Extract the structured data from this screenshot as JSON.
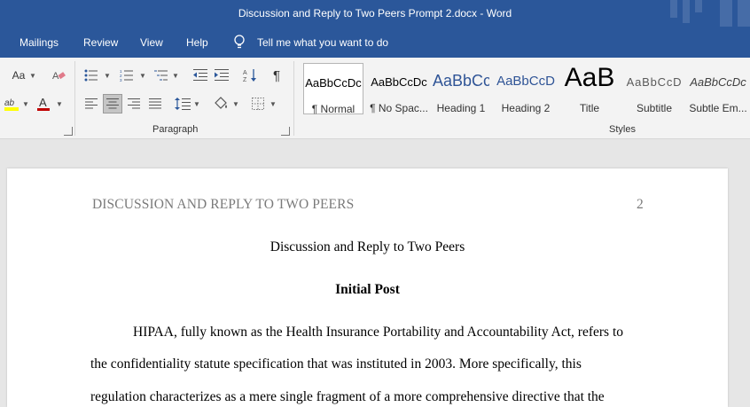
{
  "window": {
    "title": "Discussion and Reply to Two Peers Prompt 2.docx  -  Word"
  },
  "tabs": [
    {
      "label": "Mailings"
    },
    {
      "label": "Review"
    },
    {
      "label": "View"
    },
    {
      "label": "Help"
    }
  ],
  "tell_me": {
    "icon": "lightbulb-icon",
    "label": "Tell me what you want to do"
  },
  "ribbon": {
    "font_group": {
      "change_case_label": "Aa",
      "font_color": "#c00000",
      "highlight_color": "#ffff00"
    },
    "paragraph_group": {
      "label": "Paragraph",
      "active_alignment": "align-left"
    },
    "styles_group": {
      "label": "Styles",
      "items": [
        {
          "sample": "AaBbCcDc",
          "name": "¶ Normal"
        },
        {
          "sample": "AaBbCcDc",
          "name": "¶ No Spac..."
        },
        {
          "sample": "AaBbCc",
          "name": "Heading 1"
        },
        {
          "sample": "AaBbCcD",
          "name": "Heading 2"
        },
        {
          "sample": "AaB",
          "name": "Title"
        },
        {
          "sample": "AaBbCcD",
          "name": "Subtitle"
        },
        {
          "sample": "AaBbCcDc",
          "name": "Subtle Em..."
        }
      ],
      "selected": "¶ Normal"
    }
  },
  "document": {
    "running_header": "DISCUSSION AND REPLY TO TWO PEERS",
    "page_number": "2",
    "title": "Discussion and Reply to Two Peers",
    "heading": "Initial Post",
    "body_lines": [
      "HIPAA, fully known as the Health Insurance Portability and Accountability Act, refers to",
      "the confidentiality statute specification that was instituted in 2003. More specifically, this",
      "regulation characterizes as a mere single fragment of a more comprehensive directive that the"
    ]
  },
  "colors": {
    "accent": "#2b579a",
    "ribbon_bg": "#f3f3f3",
    "canvas_bg": "#e6e6e6"
  }
}
